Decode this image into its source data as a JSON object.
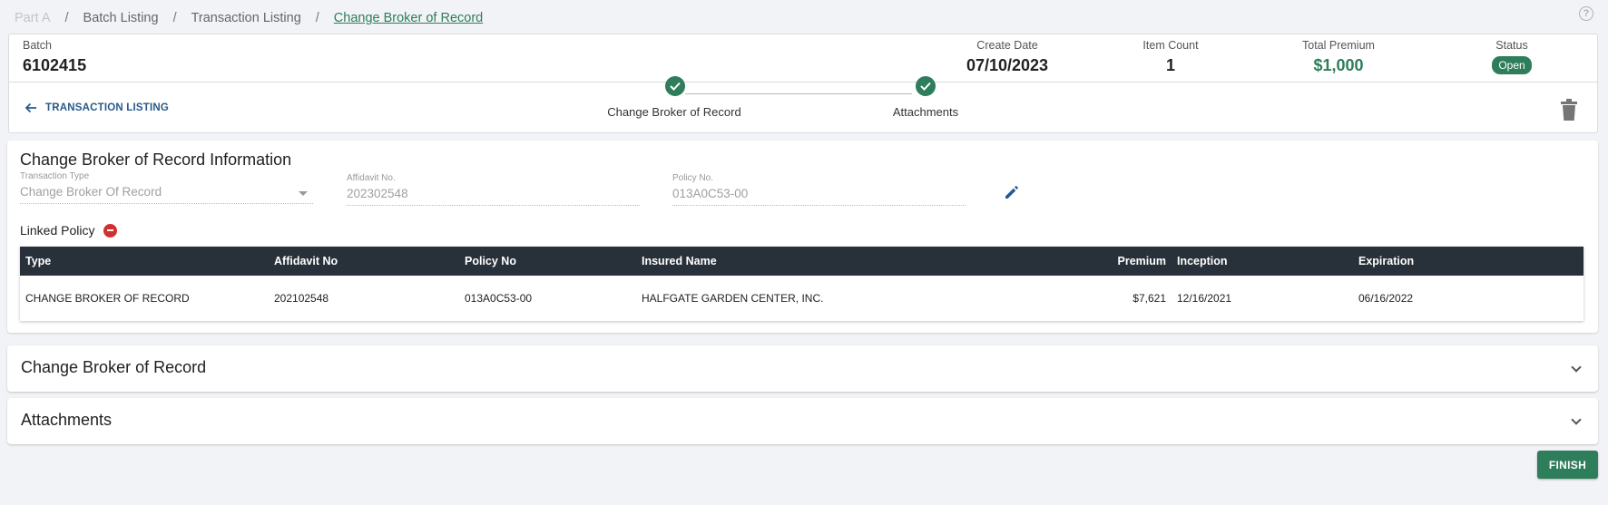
{
  "breadcrumb": {
    "items": [
      "Part A",
      "Batch Listing",
      "Transaction Listing",
      "Change Broker of Record"
    ],
    "separator": "/"
  },
  "header": {
    "batch_label": "Batch",
    "batch_value": "6102415",
    "create_date_label": "Create Date",
    "create_date_value": "07/10/2023",
    "item_count_label": "Item Count",
    "item_count_value": "1",
    "total_premium_label": "Total Premium",
    "total_premium_value": "$1,000",
    "status_label": "Status",
    "status_value": "Open"
  },
  "nav": {
    "back_label": "TRANSACTION LISTING",
    "steps": [
      {
        "label": "Change Broker of Record",
        "state": "complete"
      },
      {
        "label": "Attachments",
        "state": "complete"
      }
    ]
  },
  "info": {
    "title": "Change Broker of Record Information",
    "transaction_type_label": "Transaction Type",
    "transaction_type_value": "Change Broker Of Record",
    "affidavit_label": "Affidavit No.",
    "affidavit_value": "202302548",
    "policy_label": "Policy No.",
    "policy_value": "013A0C53-00",
    "linked_policy_label": "Linked Policy"
  },
  "table": {
    "headers": [
      "Type",
      "Affidavit No",
      "Policy No",
      "Insured Name",
      "Premium",
      "Inception",
      "Expiration"
    ],
    "rows": [
      [
        "CHANGE BROKER OF RECORD",
        "202102548",
        "013A0C53-00",
        "HALFGATE GARDEN CENTER, INC.",
        "$7,621",
        "12/16/2021",
        "06/16/2022"
      ]
    ]
  },
  "sections": {
    "broker_title": "Change Broker of Record",
    "attachments_title": "Attachments"
  },
  "actions": {
    "finish_label": "FINISH"
  },
  "colors": {
    "accent_green": "#2e7d5b",
    "table_header": "#283039",
    "link_blue": "#2a5a8a",
    "danger_red": "#d32f2f"
  }
}
